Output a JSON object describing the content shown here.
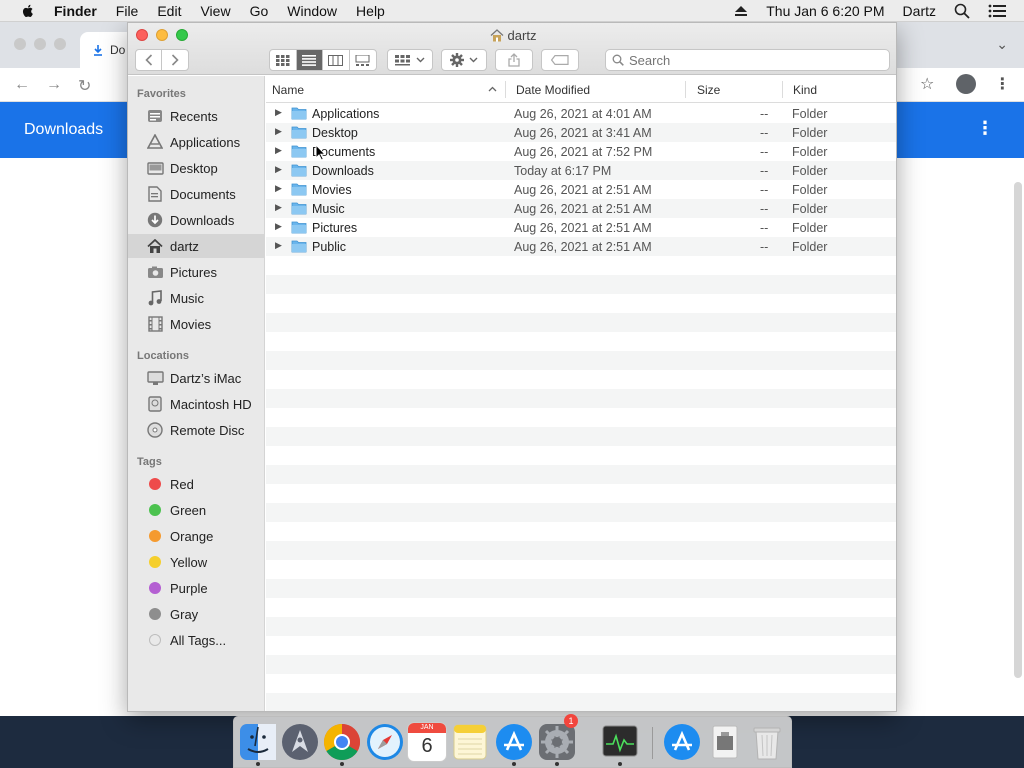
{
  "menubar": {
    "app_name": "Finder",
    "items": [
      "File",
      "Edit",
      "View",
      "Go",
      "Window",
      "Help"
    ],
    "clock": "Thu Jan 6  6:20 PM",
    "user": "Dartz"
  },
  "chrome": {
    "tab_title": "Do",
    "banner_title": "Downloads"
  },
  "finder": {
    "window_title": "dartz",
    "search_placeholder": "Search",
    "sidebar": {
      "favorites_heading": "Favorites",
      "favorites": [
        {
          "label": "Recents",
          "icon": "recents-icon"
        },
        {
          "label": "Applications",
          "icon": "applications-icon"
        },
        {
          "label": "Desktop",
          "icon": "desktop-icon"
        },
        {
          "label": "Documents",
          "icon": "documents-icon"
        },
        {
          "label": "Downloads",
          "icon": "downloads-icon"
        },
        {
          "label": "dartz",
          "icon": "home-icon",
          "selected": true
        },
        {
          "label": "Pictures",
          "icon": "pictures-icon"
        },
        {
          "label": "Music",
          "icon": "music-icon"
        },
        {
          "label": "Movies",
          "icon": "movies-icon"
        }
      ],
      "locations_heading": "Locations",
      "locations": [
        {
          "label": "Dartz’s iMac",
          "icon": "imac-icon"
        },
        {
          "label": "Macintosh HD",
          "icon": "hard-drive-icon"
        },
        {
          "label": "Remote Disc",
          "icon": "disc-icon"
        }
      ],
      "tags_heading": "Tags",
      "tags": [
        {
          "label": "Red",
          "color": "#ee4b4b"
        },
        {
          "label": "Green",
          "color": "#4cc24f"
        },
        {
          "label": "Orange",
          "color": "#f59a2f"
        },
        {
          "label": "Yellow",
          "color": "#f5cf2c"
        },
        {
          "label": "Purple",
          "color": "#b45fd2"
        },
        {
          "label": "Gray",
          "color": "#8e8e8e"
        },
        {
          "label": "All Tags...",
          "color": "#d0d0d0"
        }
      ]
    },
    "columns": {
      "name": "Name",
      "date": "Date Modified",
      "size": "Size",
      "kind": "Kind"
    },
    "files": [
      {
        "name": "Applications",
        "date": "Aug 26, 2021 at 4:01 AM",
        "size": "--",
        "kind": "Folder"
      },
      {
        "name": "Desktop",
        "date": "Aug 26, 2021 at 3:41 AM",
        "size": "--",
        "kind": "Folder"
      },
      {
        "name": "Documents",
        "date": "Aug 26, 2021 at 7:52 PM",
        "size": "--",
        "kind": "Folder"
      },
      {
        "name": "Downloads",
        "date": "Today at 6:17 PM",
        "size": "--",
        "kind": "Folder"
      },
      {
        "name": "Movies",
        "date": "Aug 26, 2021 at 2:51 AM",
        "size": "--",
        "kind": "Folder"
      },
      {
        "name": "Music",
        "date": "Aug 26, 2021 at 2:51 AM",
        "size": "--",
        "kind": "Folder"
      },
      {
        "name": "Pictures",
        "date": "Aug 26, 2021 at 2:51 AM",
        "size": "--",
        "kind": "Folder"
      },
      {
        "name": "Public",
        "date": "Aug 26, 2021 at 2:51 AM",
        "size": "--",
        "kind": "Folder"
      }
    ]
  },
  "dock": {
    "calendar_month": "JAN",
    "calendar_day": "6",
    "system_prefs_badge": "1"
  },
  "colors": {
    "chrome_banner": "#1a73e8",
    "folder_blue": "#5aaee8",
    "selection_gray": "#d5d5d5"
  }
}
